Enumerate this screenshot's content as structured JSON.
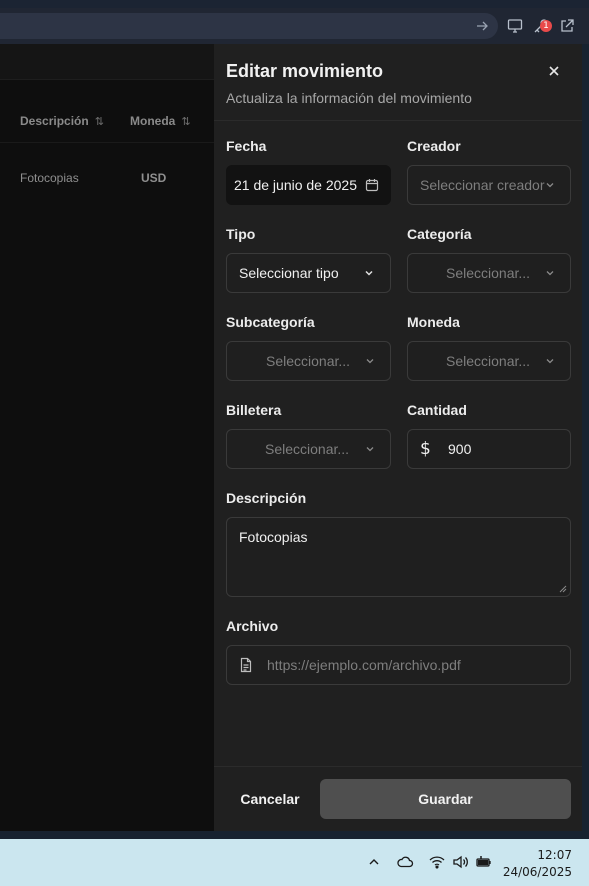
{
  "background_table": {
    "columns": [
      {
        "label": "Descripción"
      },
      {
        "label": "Moneda"
      }
    ],
    "rows": [
      {
        "descripcion": "Fotocopias",
        "moneda": "USD"
      }
    ]
  },
  "browser": {
    "extension_badge": "1"
  },
  "panel": {
    "title": "Editar movimiento",
    "subtitle": "Actualiza la información del movimiento",
    "fields": {
      "fecha": {
        "label": "Fecha",
        "value": "21 de junio de 2025"
      },
      "creador": {
        "label": "Creador",
        "placeholder": "Seleccionar creador"
      },
      "tipo": {
        "label": "Tipo",
        "value": "Seleccionar tipo"
      },
      "categoria": {
        "label": "Categoría",
        "placeholder": "Seleccionar..."
      },
      "subcategoria": {
        "label": "Subcategoría",
        "placeholder": "Seleccionar..."
      },
      "moneda": {
        "label": "Moneda",
        "placeholder": "Seleccionar..."
      },
      "billetera": {
        "label": "Billetera",
        "placeholder": "Seleccionar..."
      },
      "cantidad": {
        "label": "Cantidad",
        "currency_symbol": "$",
        "value": "900"
      },
      "descripcion": {
        "label": "Descripción",
        "value": "Fotocopias"
      },
      "archivo": {
        "label": "Archivo",
        "placeholder": "https://ejemplo.com/archivo.pdf"
      }
    },
    "buttons": {
      "cancel": "Cancelar",
      "save": "Guardar"
    }
  },
  "taskbar": {
    "time": "12:07",
    "date": "24/06/2025"
  },
  "colors": {
    "panel_bg": "#202020",
    "save_button_bg": "#4f4f4f",
    "badge": "#e84a4a",
    "taskbar_bg": "#cbe6ef"
  }
}
